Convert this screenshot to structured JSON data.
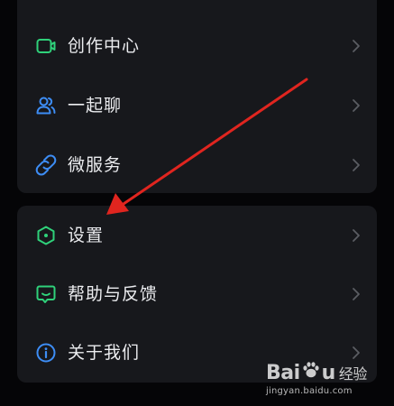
{
  "menu_top": {
    "items": [
      {
        "label": "创作中心",
        "icon": "video-camera-icon",
        "color": "#2fd17a"
      },
      {
        "label": "一起聊",
        "icon": "people-icon",
        "color": "#3d8df5"
      },
      {
        "label": "微服务",
        "icon": "link-icon",
        "color": "#3d8df5"
      }
    ]
  },
  "menu_bottom": {
    "items": [
      {
        "label": "设置",
        "icon": "hexagon-settings-icon",
        "color": "#2fd17a"
      },
      {
        "label": "帮助与反馈",
        "icon": "chat-bubble-icon",
        "color": "#2fd17a"
      },
      {
        "label": "关于我们",
        "icon": "info-icon",
        "color": "#3d8df5"
      }
    ]
  },
  "chevron_icon": "chevron-right-icon",
  "annotation": {
    "type": "red-arrow",
    "color": "#e0251f",
    "points_to": "设置"
  },
  "watermark": {
    "brand_prefix": "Bai",
    "brand_suffix": "u",
    "brand_cn": "经验",
    "url": "jingyan.baidu.com"
  }
}
